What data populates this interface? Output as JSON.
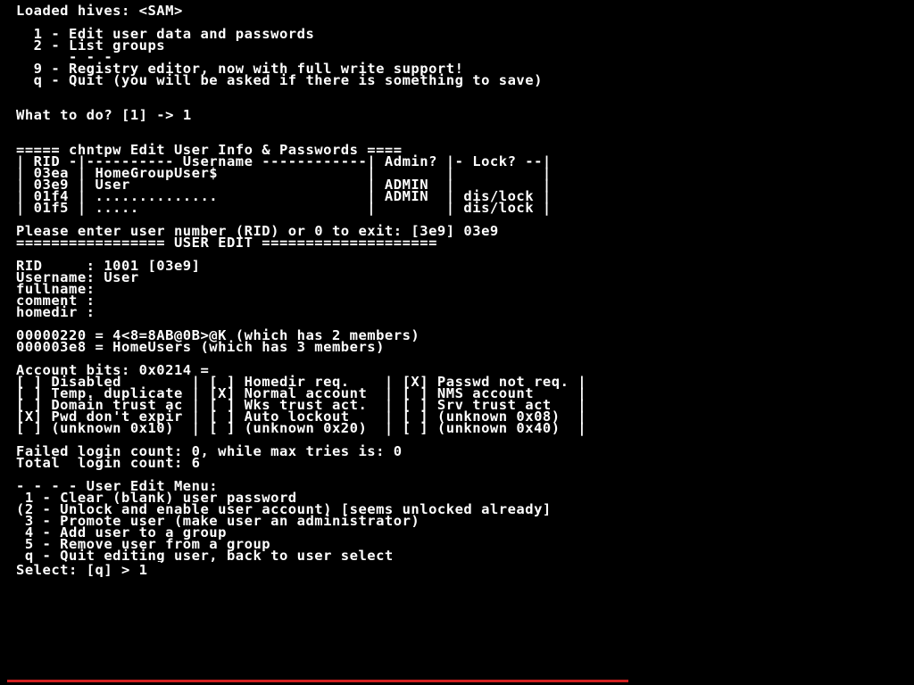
{
  "header": "Loaded hives: <SAM>",
  "menu": {
    "opt1": "  1 - Edit user data and passwords",
    "opt2": "  2 - List groups",
    "divider": "      - - -",
    "opt9": "  9 - Registry editor, now with full write support!",
    "optq": "  q - Quit (you will be asked if there is something to save)"
  },
  "prompt1": {
    "label": "What to do? [1] -> ",
    "value": "1"
  },
  "section_title": "===== chntpw Edit User Info & Passwords ====",
  "user_table": [
    "| RID -|---------- Username ------------| Admin? |- Lock? --|",
    "| 03ea | HomeGroupUser$                 |        |          |",
    "| 03e9 | User                           | ADMIN  |          |",
    "| 01f4 | ..............                 | ADMIN  | dis/lock |",
    "| 01f5 | .....                          |        | dis/lock |"
  ],
  "rid_prompt": {
    "label": "Please enter user number (RID) or 0 to exit: [3e9] ",
    "value": "03e9"
  },
  "user_edit_hdr": "================= USER EDIT ====================",
  "user_info": [
    "RID     : 1001 [03e9]",
    "Username: User",
    "fullname:",
    "comment :",
    "homedir :"
  ],
  "groups": [
    "00000220 = 4<8=8AB@0B>@K (which has 2 members)",
    "000003e8 = HomeUsers (which has 3 members)"
  ],
  "account_bits_hdr": "Account bits: 0x0214 =",
  "account_bits": [
    "[ ] Disabled        | [ ] Homedir req.    | [X] Passwd not req. |",
    "[ ] Temp. duplicate | [X] Normal account  | [ ] NMS account     |",
    "[ ] Domain trust ac | [ ] Wks trust act.  | [ ] Srv trust act   |",
    "[X] Pwd don't expir | [ ] Auto lockout    | [ ] (unknown 0x08)  |",
    "[ ] (unknown 0x10)  | [ ] (unknown 0x20)  | [ ] (unknown 0x40)  |"
  ],
  "login_counts": [
    "Failed login count: 0, while max tries is: 0",
    "Total  login count: 6"
  ],
  "edit_menu": {
    "hdr": "- - - - User Edit Menu:",
    "o1": " 1 - Clear (blank) user password",
    "o2": "(2 - Unlock and enable user account) [seems unlocked already]",
    "o3": " 3 - Promote user (make user an administrator)",
    "o4": " 4 - Add user to a group",
    "o5": " 5 - Remove user from a group",
    "oq": " q - Quit editing user, back to user select"
  },
  "select_prompt": {
    "label": "Select: [q] > ",
    "value": "1"
  },
  "colors": {
    "underline": "#d02020"
  }
}
